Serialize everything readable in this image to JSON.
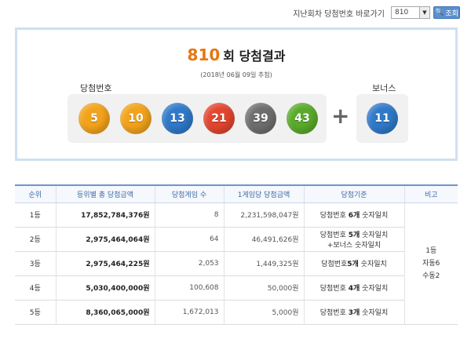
{
  "nav": {
    "label": "지난회차 당첨번호 바로가기",
    "selected_round": "810",
    "search_label": "조회"
  },
  "result": {
    "round": "810",
    "title_suffix": "회 당첨결과",
    "date": "(2018년 06월 09일 추첨)",
    "win_label": "당첨번호",
    "bonus_label": "보너스",
    "numbers": [
      {
        "value": "5",
        "color": "#f2a31b"
      },
      {
        "value": "10",
        "color": "#f2a31b"
      },
      {
        "value": "13",
        "color": "#2f79c9"
      },
      {
        "value": "21",
        "color": "#e2462f"
      },
      {
        "value": "39",
        "color": "#6e6e6e"
      },
      {
        "value": "43",
        "color": "#5aab2a"
      }
    ],
    "bonus": {
      "value": "11",
      "color": "#2f79c9"
    },
    "plus": "+"
  },
  "table": {
    "headers": [
      "순위",
      "등위별 총 당첨금액",
      "당첨게임 수",
      "1게임당 당첨금액",
      "당첨기준",
      "비고"
    ],
    "rows": [
      {
        "rank": "1등",
        "total": "17,852,784,376원",
        "games": "8",
        "per": "2,231,598,047원",
        "crit_pre": "당첨번호 ",
        "crit_bold": "6개",
        "crit_post": " 숫자일치",
        "crit2": ""
      },
      {
        "rank": "2등",
        "total": "2,975,464,064원",
        "games": "64",
        "per": "46,491,626원",
        "crit_pre": "당첨번호 ",
        "crit_bold": "5개",
        "crit_post": " 숫자일치",
        "crit2": "+보너스 숫자일치"
      },
      {
        "rank": "3등",
        "total": "2,975,464,225원",
        "games": "2,053",
        "per": "1,449,325원",
        "crit_pre": "당첨번호",
        "crit_bold": "5개",
        "crit_post": " 숫자일치",
        "crit2": ""
      },
      {
        "rank": "4등",
        "total": "5,030,400,000원",
        "games": "100,608",
        "per": "50,000원",
        "crit_pre": "당첨번호 ",
        "crit_bold": "4개",
        "crit_post": " 숫자일치",
        "crit2": ""
      },
      {
        "rank": "5등",
        "total": "8,360,065,000원",
        "games": "1,672,013",
        "per": "5,000원",
        "crit_pre": "당첨번호 ",
        "crit_bold": "3개",
        "crit_post": " 숫자일치",
        "crit2": ""
      }
    ],
    "note": [
      "1등",
      "자동6",
      "수동2"
    ]
  }
}
